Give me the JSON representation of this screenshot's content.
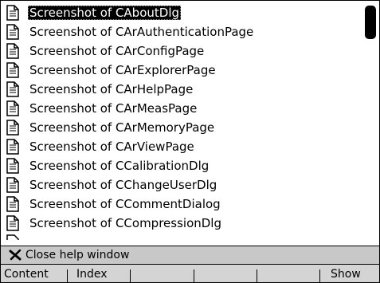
{
  "help_list": {
    "icon": "document-icon",
    "selected_index": 0,
    "items": [
      "Screenshot of CAboutDlg",
      "Screenshot of CArAuthenticationPage",
      "Screenshot of CArConfigPage",
      "Screenshot of CArExplorerPage",
      "Screenshot of CArHelpPage",
      "Screenshot of CArMeasPage",
      "Screenshot of CArMemoryPage",
      "Screenshot of CArViewPage",
      "Screenshot of CCalibrationDlg",
      "Screenshot of CChangeUserDlg",
      "Screenshot of CCommentDialog",
      "Screenshot of CCompressionDlg"
    ]
  },
  "status": {
    "close_icon": "close-x-icon",
    "close_label": "Close help window"
  },
  "menu": {
    "content_label": "Content",
    "index_label": "Index",
    "show_label": "Show"
  },
  "colors": {
    "selection": "#000000",
    "status_bar": "#c8c8c8",
    "menu_bar": "#d4d4d4"
  }
}
